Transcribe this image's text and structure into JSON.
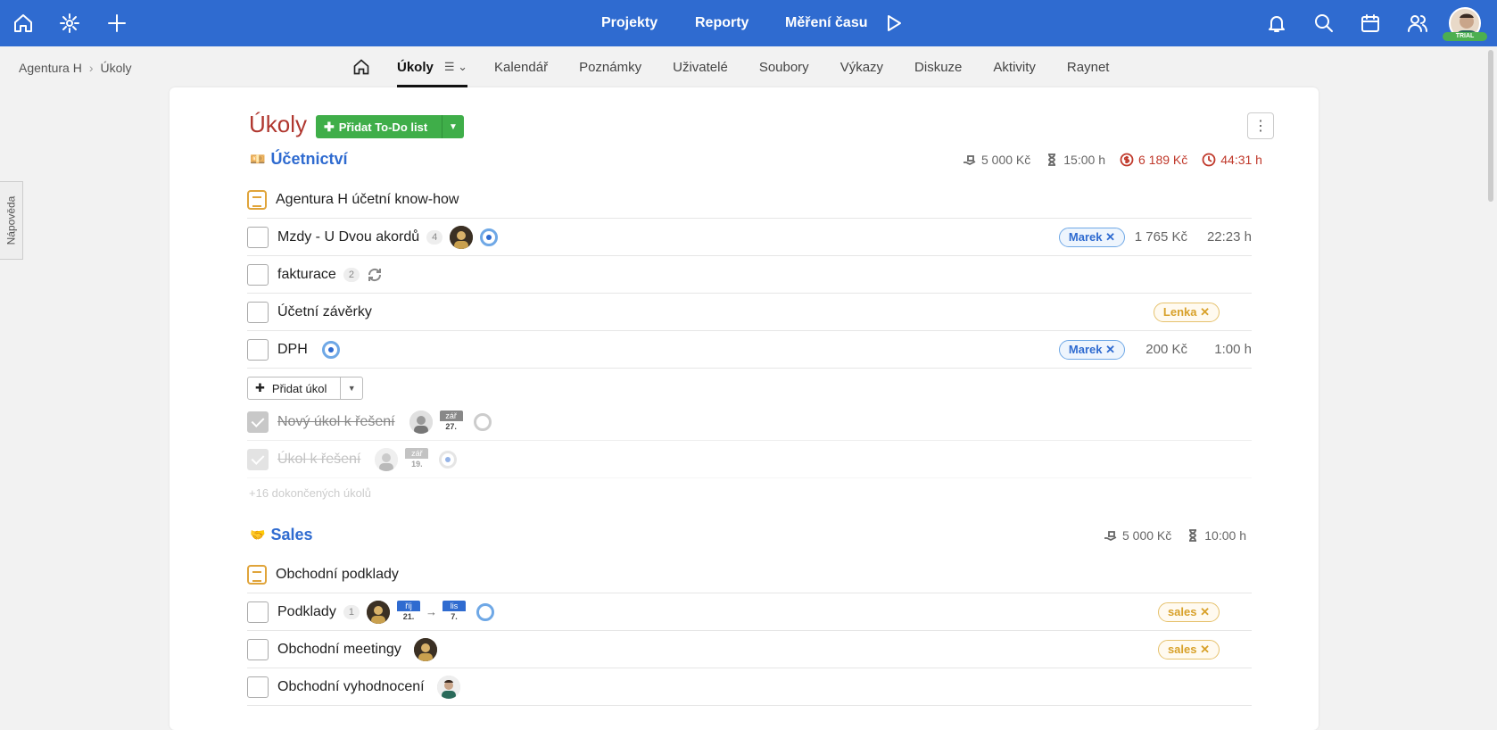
{
  "topbar": {
    "nav": [
      "Projekty",
      "Reporty",
      "Měření času"
    ],
    "trial": "TRIAL",
    "icons": [
      "home-icon",
      "settings-icon",
      "plus-icon",
      "play-icon",
      "bell-icon",
      "search-icon",
      "calendar-icon",
      "users-icon"
    ]
  },
  "breadcrumb": {
    "project": "Agentura H",
    "page": "Úkoly"
  },
  "tabs": [
    "Úkoly",
    "Kalendář",
    "Poznámky",
    "Uživatelé",
    "Soubory",
    "Výkazy",
    "Diskuze",
    "Aktivity",
    "Raynet"
  ],
  "help": "Nápověda",
  "page": {
    "title": "Úkoly",
    "add_list": "Přidat To-Do list"
  },
  "sections": [
    {
      "title": "Účetnictví",
      "emoji": "💴",
      "stats": {
        "budget": "5 000 Kč",
        "estimate": "15:00 h",
        "spent": "6 189 Kč",
        "time": "44:31 h"
      },
      "list_name": "Agentura H účetní know-how",
      "tasks": [
        {
          "name": "Mzdy - U Dvou akordů",
          "count": "4",
          "tag": "Marek",
          "amount": "1 765 Kč",
          "time": "22:23 h"
        },
        {
          "name": "fakturace",
          "count": "2"
        },
        {
          "name": "Účetní závěrky",
          "tag": "Lenka"
        },
        {
          "name": "DPH",
          "tag": "Marek",
          "amount": "200 Kč",
          "time": "1:00 h"
        }
      ],
      "add_task": "Přidat úkol",
      "done_tasks": [
        {
          "name": "Nový úkol k řešení",
          "month": "zář",
          "day": "27."
        },
        {
          "name": "Úkol k řešení",
          "month": "zář",
          "day": "19."
        }
      ],
      "completed_link": "+16 dokončených úkolů"
    },
    {
      "title": "Sales",
      "emoji": "🤝",
      "stats": {
        "budget": "5 000 Kč",
        "estimate": "10:00 h"
      },
      "list_name": "Obchodní podklady",
      "tasks": [
        {
          "name": "Podklady",
          "count": "1",
          "from_month": "říj",
          "from_day": "21.",
          "to_month": "lis",
          "to_day": "7.",
          "tag": "sales"
        },
        {
          "name": "Obchodní meetingy",
          "tag": "sales"
        },
        {
          "name": "Obchodní vyhodnocení"
        }
      ]
    }
  ]
}
